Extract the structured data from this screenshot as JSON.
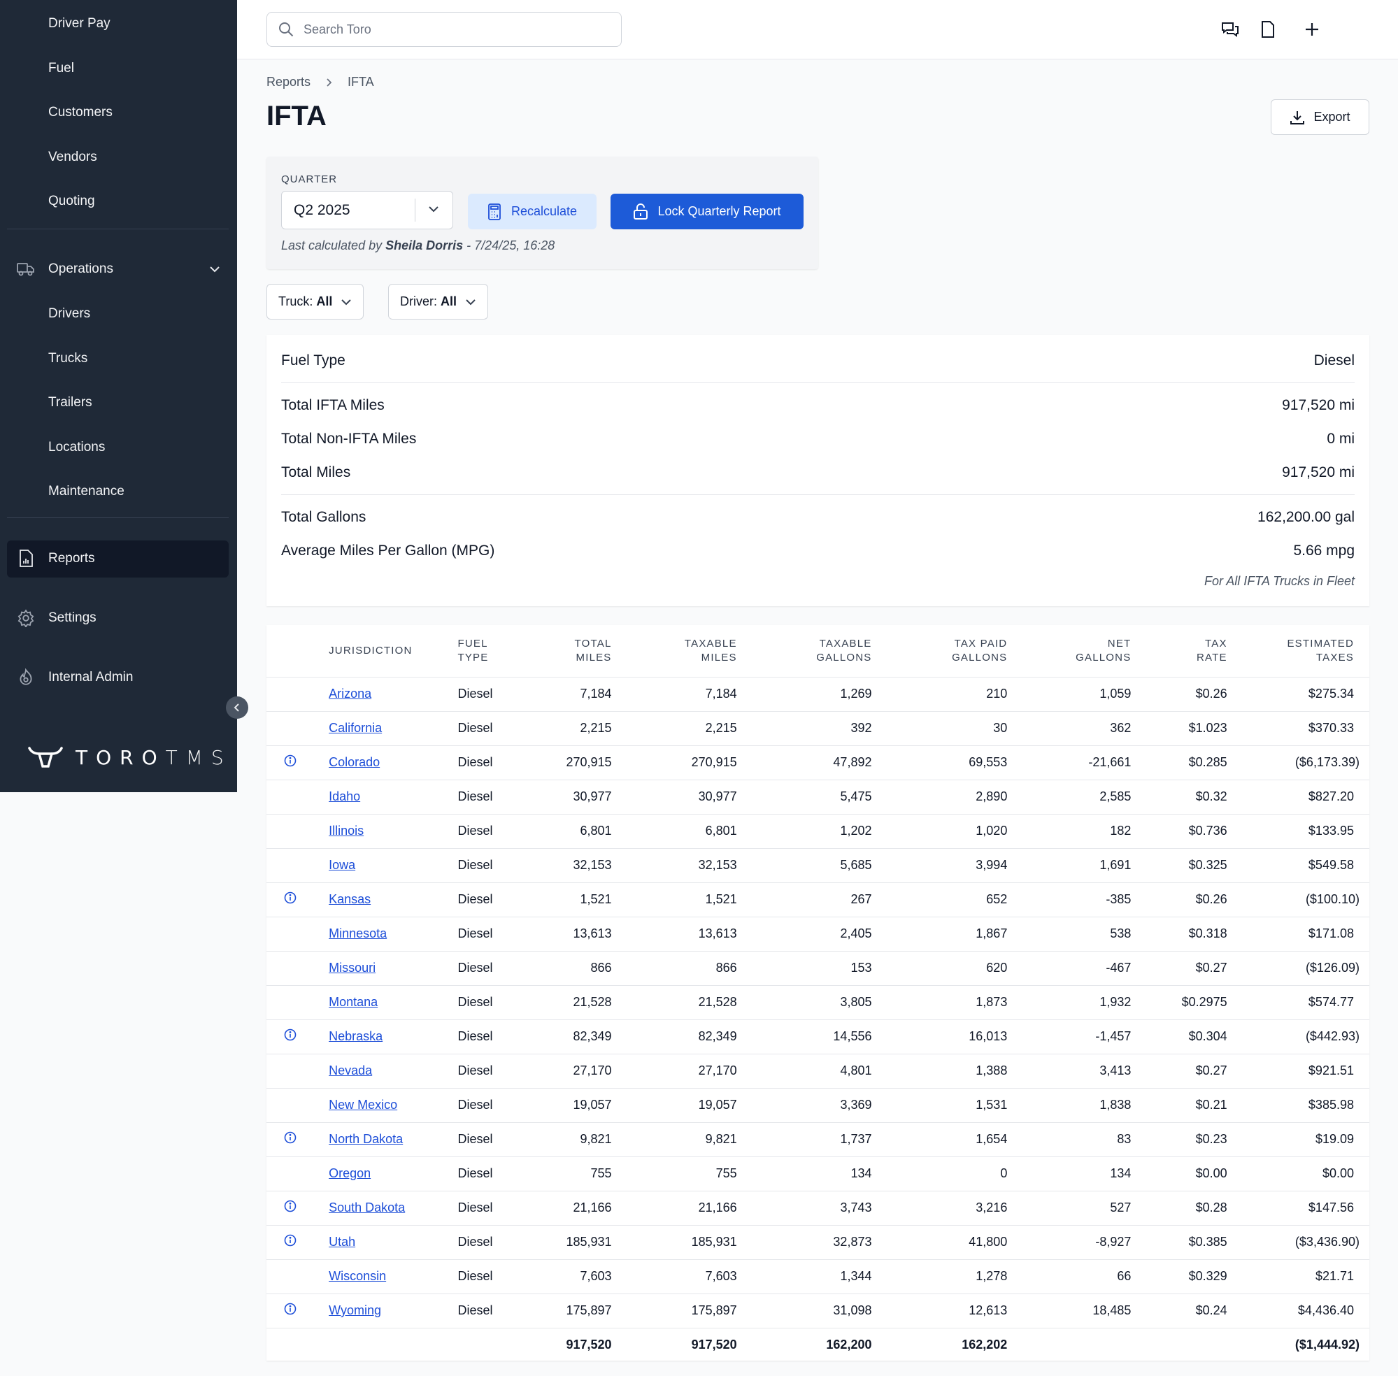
{
  "sidebar": {
    "sub_top": [
      "Driver Pay",
      "Fuel",
      "Customers",
      "Vendors",
      "Quoting"
    ],
    "operations_label": "Operations",
    "operations_items": [
      "Drivers",
      "Trucks",
      "Trailers",
      "Locations",
      "Maintenance"
    ],
    "reports_label": "Reports",
    "settings_label": "Settings",
    "internal_admin_label": "Internal Admin",
    "logo_text_bold": "TORO",
    "logo_text_light": "TMS"
  },
  "topbar": {
    "search_placeholder": "Search Toro"
  },
  "breadcrumb": [
    "Reports",
    "IFTA"
  ],
  "page_title": "IFTA",
  "export_label": "Export",
  "quarter": {
    "label": "QUARTER",
    "selected": "Q2 2025",
    "recalculate_label": "Recalculate",
    "lock_label": "Lock Quarterly Report",
    "last_calc_prefix": "Last calculated by",
    "last_calc_user": "Sheila Dorris",
    "last_calc_suffix": "- 7/24/25, 16:28"
  },
  "filters": {
    "truck_label": "Truck:",
    "truck_value": "All",
    "driver_label": "Driver:",
    "driver_value": "All"
  },
  "summary": {
    "rows": [
      {
        "label": "Fuel Type",
        "value": "Diesel"
      },
      {
        "label": "Total IFTA Miles",
        "value": "917,520 mi"
      },
      {
        "label": "Total Non-IFTA Miles",
        "value": "0 mi"
      },
      {
        "label": "Total Miles",
        "value": "917,520 mi"
      },
      {
        "label": "Total Gallons",
        "value": "162,200.00 gal"
      },
      {
        "label": "Average Miles Per Gallon (MPG)",
        "value": "5.66 mpg"
      }
    ],
    "note": "For All IFTA Trucks in Fleet"
  },
  "table": {
    "headers": {
      "jurisdiction": "JURISDICTION",
      "fuel_type_1": "FUEL",
      "fuel_type_2": "TYPE",
      "total_miles_1": "TOTAL",
      "total_miles_2": "MILES",
      "taxable_miles_1": "TAXABLE",
      "taxable_miles_2": "MILES",
      "taxable_gallons_1": "TAXABLE",
      "taxable_gallons_2": "GALLONS",
      "tax_paid_1": "TAX PAID",
      "tax_paid_2": "GALLONS",
      "net_gallons_1": "NET",
      "net_gallons_2": "GALLONS",
      "tax_rate_1": "TAX",
      "tax_rate_2": "RATE",
      "estimated_1": "ESTIMATED",
      "estimated_2": "TAXES"
    },
    "rows": [
      {
        "info": false,
        "jurisdiction": "Arizona",
        "fuel": "Diesel",
        "total_miles": "7,184",
        "taxable_miles": "7,184",
        "taxable_gallons": "1,269",
        "tax_paid": "210",
        "net": "1,059",
        "rate": "$0.26",
        "est": "$275.34"
      },
      {
        "info": false,
        "jurisdiction": "California",
        "fuel": "Diesel",
        "total_miles": "2,215",
        "taxable_miles": "2,215",
        "taxable_gallons": "392",
        "tax_paid": "30",
        "net": "362",
        "rate": "$1.023",
        "est": "$370.33"
      },
      {
        "info": true,
        "jurisdiction": "Colorado",
        "fuel": "Diesel",
        "total_miles": "270,915",
        "taxable_miles": "270,915",
        "taxable_gallons": "47,892",
        "tax_paid": "69,553",
        "net": "-21,661",
        "rate": "$0.285",
        "est": "($6,173.39)"
      },
      {
        "info": false,
        "jurisdiction": "Idaho",
        "fuel": "Diesel",
        "total_miles": "30,977",
        "taxable_miles": "30,977",
        "taxable_gallons": "5,475",
        "tax_paid": "2,890",
        "net": "2,585",
        "rate": "$0.32",
        "est": "$827.20"
      },
      {
        "info": false,
        "jurisdiction": "Illinois",
        "fuel": "Diesel",
        "total_miles": "6,801",
        "taxable_miles": "6,801",
        "taxable_gallons": "1,202",
        "tax_paid": "1,020",
        "net": "182",
        "rate": "$0.736",
        "est": "$133.95"
      },
      {
        "info": false,
        "jurisdiction": "Iowa",
        "fuel": "Diesel",
        "total_miles": "32,153",
        "taxable_miles": "32,153",
        "taxable_gallons": "5,685",
        "tax_paid": "3,994",
        "net": "1,691",
        "rate": "$0.325",
        "est": "$549.58"
      },
      {
        "info": true,
        "jurisdiction": "Kansas",
        "fuel": "Diesel",
        "total_miles": "1,521",
        "taxable_miles": "1,521",
        "taxable_gallons": "267",
        "tax_paid": "652",
        "net": "-385",
        "rate": "$0.26",
        "est": "($100.10)"
      },
      {
        "info": false,
        "jurisdiction": "Minnesota",
        "fuel": "Diesel",
        "total_miles": "13,613",
        "taxable_miles": "13,613",
        "taxable_gallons": "2,405",
        "tax_paid": "1,867",
        "net": "538",
        "rate": "$0.318",
        "est": "$171.08"
      },
      {
        "info": false,
        "jurisdiction": "Missouri",
        "fuel": "Diesel",
        "total_miles": "866",
        "taxable_miles": "866",
        "taxable_gallons": "153",
        "tax_paid": "620",
        "net": "-467",
        "rate": "$0.27",
        "est": "($126.09)"
      },
      {
        "info": false,
        "jurisdiction": "Montana",
        "fuel": "Diesel",
        "total_miles": "21,528",
        "taxable_miles": "21,528",
        "taxable_gallons": "3,805",
        "tax_paid": "1,873",
        "net": "1,932",
        "rate": "$0.2975",
        "est": "$574.77"
      },
      {
        "info": true,
        "jurisdiction": "Nebraska",
        "fuel": "Diesel",
        "total_miles": "82,349",
        "taxable_miles": "82,349",
        "taxable_gallons": "14,556",
        "tax_paid": "16,013",
        "net": "-1,457",
        "rate": "$0.304",
        "est": "($442.93)"
      },
      {
        "info": false,
        "jurisdiction": "Nevada",
        "fuel": "Diesel",
        "total_miles": "27,170",
        "taxable_miles": "27,170",
        "taxable_gallons": "4,801",
        "tax_paid": "1,388",
        "net": "3,413",
        "rate": "$0.27",
        "est": "$921.51"
      },
      {
        "info": false,
        "jurisdiction": "New Mexico",
        "fuel": "Diesel",
        "total_miles": "19,057",
        "taxable_miles": "19,057",
        "taxable_gallons": "3,369",
        "tax_paid": "1,531",
        "net": "1,838",
        "rate": "$0.21",
        "est": "$385.98"
      },
      {
        "info": true,
        "jurisdiction": "North Dakota",
        "fuel": "Diesel",
        "total_miles": "9,821",
        "taxable_miles": "9,821",
        "taxable_gallons": "1,737",
        "tax_paid": "1,654",
        "net": "83",
        "rate": "$0.23",
        "est": "$19.09"
      },
      {
        "info": false,
        "jurisdiction": "Oregon",
        "fuel": "Diesel",
        "total_miles": "755",
        "taxable_miles": "755",
        "taxable_gallons": "134",
        "tax_paid": "0",
        "net": "134",
        "rate": "$0.00",
        "est": "$0.00"
      },
      {
        "info": true,
        "jurisdiction": "South Dakota",
        "fuel": "Diesel",
        "total_miles": "21,166",
        "taxable_miles": "21,166",
        "taxable_gallons": "3,743",
        "tax_paid": "3,216",
        "net": "527",
        "rate": "$0.28",
        "est": "$147.56"
      },
      {
        "info": true,
        "jurisdiction": "Utah",
        "fuel": "Diesel",
        "total_miles": "185,931",
        "taxable_miles": "185,931",
        "taxable_gallons": "32,873",
        "tax_paid": "41,800",
        "net": "-8,927",
        "rate": "$0.385",
        "est": "($3,436.90)"
      },
      {
        "info": false,
        "jurisdiction": "Wisconsin",
        "fuel": "Diesel",
        "total_miles": "7,603",
        "taxable_miles": "7,603",
        "taxable_gallons": "1,344",
        "tax_paid": "1,278",
        "net": "66",
        "rate": "$0.329",
        "est": "$21.71"
      },
      {
        "info": true,
        "jurisdiction": "Wyoming",
        "fuel": "Diesel",
        "total_miles": "175,897",
        "taxable_miles": "175,897",
        "taxable_gallons": "31,098",
        "tax_paid": "12,613",
        "net": "18,485",
        "rate": "$0.24",
        "est": "$4,436.40"
      }
    ],
    "totals": {
      "total_miles": "917,520",
      "taxable_miles": "917,520",
      "taxable_gallons": "162,200",
      "tax_paid": "162,202",
      "est": "($1,444.92)"
    }
  },
  "colors": {
    "sidebar_bg": "#1f2937",
    "accent": "#1d5bd8",
    "link": "#1d4ed8"
  },
  "icons": [
    "search-icon",
    "chat-icon",
    "document-icon",
    "plus-icon",
    "truck-icon",
    "chevron-down-icon",
    "reports-icon",
    "gear-icon",
    "admin-icon",
    "chevron-left-icon",
    "download-icon",
    "calculator-icon",
    "lock-icon",
    "info-icon"
  ]
}
